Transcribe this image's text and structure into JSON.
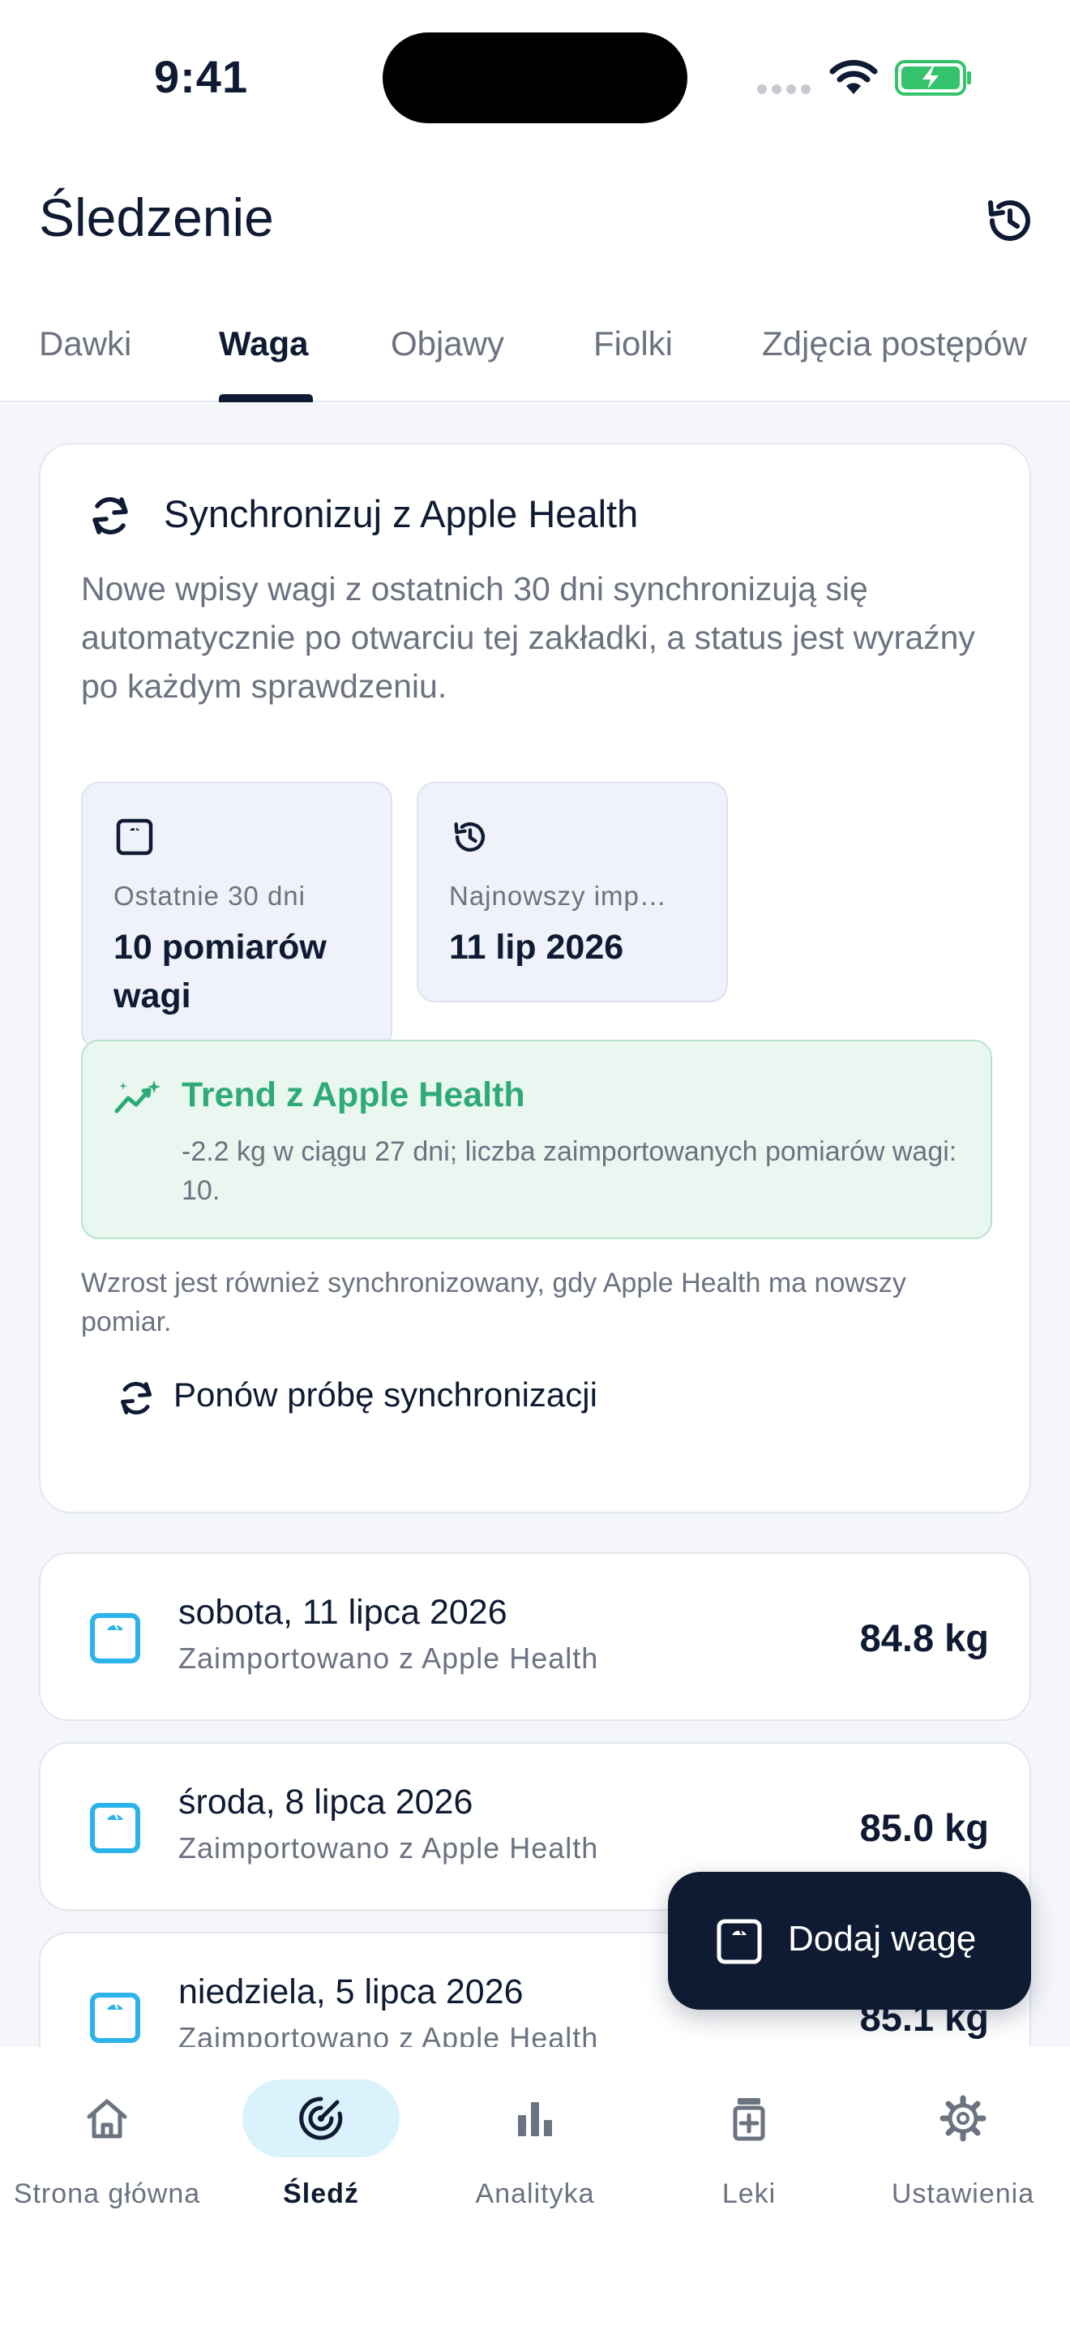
{
  "status_bar": {
    "time": "9:41"
  },
  "header": {
    "title": "Śledzenie",
    "history_icon": "history-icon"
  },
  "tabs": [
    {
      "label": "Dawki",
      "active": false
    },
    {
      "label": "Waga",
      "active": true
    },
    {
      "label": "Objawy",
      "active": false
    },
    {
      "label": "Fiolki",
      "active": false
    },
    {
      "label": "Zdjęcia postępów",
      "active": false
    }
  ],
  "sync_card": {
    "title": "Synchronizuj z Apple Health",
    "description": "Nowe wpisy wagi z ostatnich 30 dni synchronizują się automatycznie po otwarciu tej zakładki, a status jest wyraźny po każdym sprawdzeniu.",
    "stats": [
      {
        "label": "Ostatnie 30 dni",
        "value": "10 pomiarów wagi",
        "icon": "scale-icon"
      },
      {
        "label": "Najnowszy imp…",
        "value": "11 lip 2026",
        "icon": "history-icon"
      }
    ],
    "trend": {
      "title": "Trend z Apple Health",
      "text": "-2.2 kg w ciągu 27 dni; liczba zaimportowanych pomiarów wagi: 10."
    },
    "height_note": "Wzrost jest również synchronizowany, gdy Apple Health ma nowszy pomiar.",
    "retry_label": "Ponów próbę synchronizacji"
  },
  "entries": [
    {
      "date": "sobota, 11 lipca 2026",
      "source": "Zaimportowano z Apple Health",
      "weight": "84.8 kg"
    },
    {
      "date": "środa, 8 lipca 2026",
      "source": "Zaimportowano z Apple Health",
      "weight": "85.0 kg"
    },
    {
      "date": "niedziela, 5 lipca 2026",
      "source": "Zaimportowano z Apple Health",
      "weight": "85.1 kg"
    }
  ],
  "fab": {
    "label": "Dodaj wagę"
  },
  "bottom_nav": [
    {
      "label": "Strona główna",
      "icon": "home-icon",
      "active": false
    },
    {
      "label": "Śledź",
      "icon": "track-icon",
      "active": true
    },
    {
      "label": "Analityka",
      "icon": "bar-chart-icon",
      "active": false
    },
    {
      "label": "Leki",
      "icon": "medication-icon",
      "active": false
    },
    {
      "label": "Ustawienia",
      "icon": "gear-icon",
      "active": false
    }
  ],
  "colors": {
    "text_primary": "#0f1a33",
    "text_secondary": "#6b7280",
    "accent_green": "#2eaa78",
    "accent_blue": "#2bb3ea",
    "active_nav_bg": "#d9f2fb",
    "fab_bg": "#0f1a33"
  }
}
